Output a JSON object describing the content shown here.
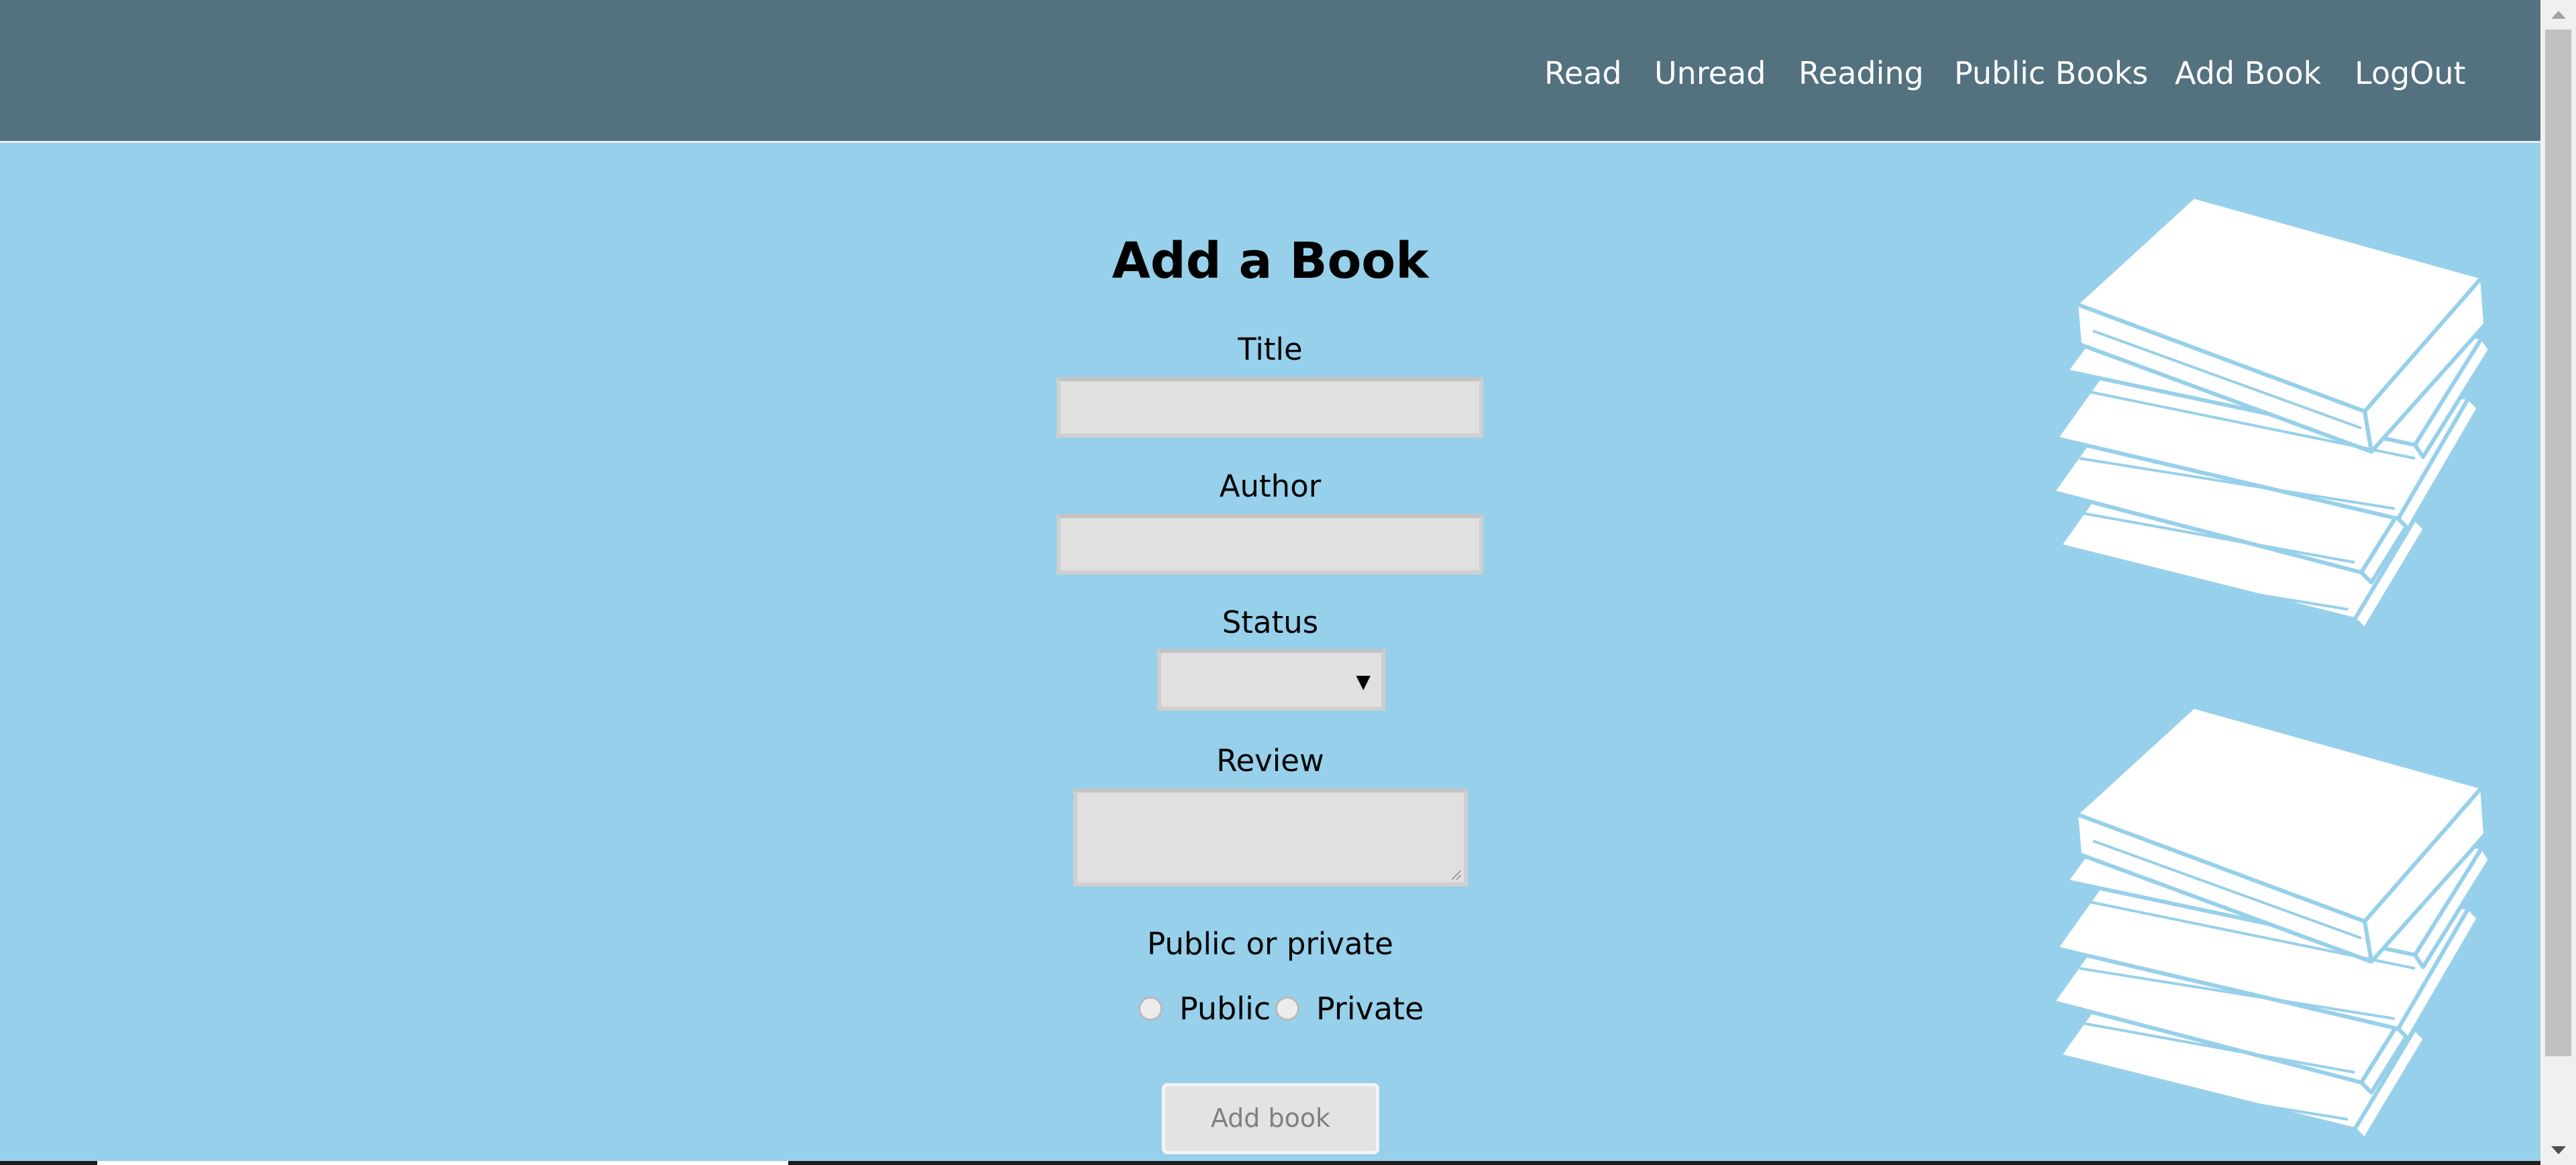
{
  "nav": {
    "items": [
      {
        "label": "Read"
      },
      {
        "label": "Unread"
      },
      {
        "label": "Reading"
      },
      {
        "label": "Public Books"
      },
      {
        "label": "Add Book"
      },
      {
        "label": "LogOut"
      }
    ]
  },
  "form": {
    "title": "Add a Book",
    "title_label": "Title",
    "title_value": "",
    "author_label": "Author",
    "author_value": "",
    "status_label": "Status",
    "status_value": "",
    "review_label": "Review",
    "review_value": "",
    "visibility_label": "Public or private",
    "public_label": "Public",
    "private_label": "Private",
    "submit_label": "Add book"
  },
  "icons": {
    "select_arrow": "chevron-down-icon",
    "decoration": "book-stack-icon"
  },
  "colors": {
    "nav_background": "#53717f",
    "page_background": "#97d0ea",
    "input_background": "#e0e0e0"
  }
}
